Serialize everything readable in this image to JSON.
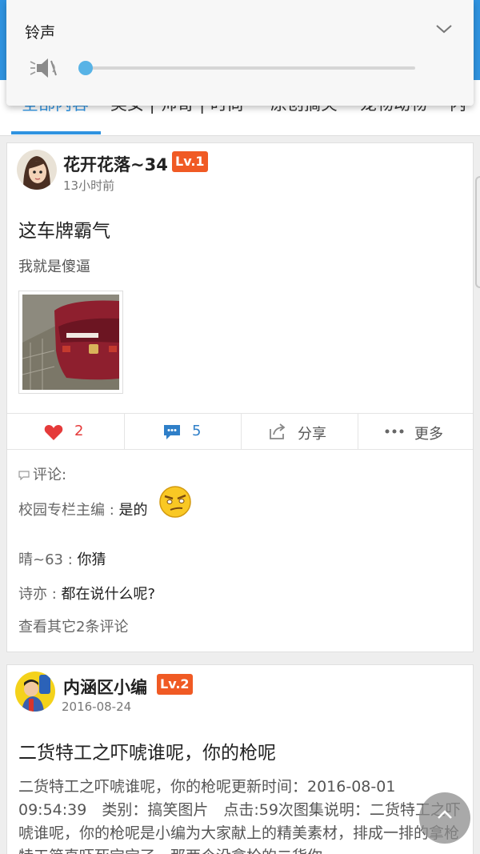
{
  "volume_panel": {
    "title": "铃声",
    "level_percent": 0,
    "icons": [
      "chevron-down-icon",
      "speaker-mute-icon"
    ],
    "accent_color": "#58b3e6"
  },
  "tabs": [
    {
      "label": "全部内容",
      "active": true
    },
    {
      "label": "美女 | 帅哥 | 时尚",
      "active": false
    },
    {
      "label": "原创搞笑",
      "active": false
    },
    {
      "label": "宠物动物",
      "active": false
    },
    {
      "label": "内",
      "active": false
    }
  ],
  "brand_color": "#2f93e0",
  "posts": [
    {
      "username": "花开花落~34",
      "level": "Lv.1",
      "time": "13小时前",
      "title": "这车牌霸气",
      "subtitle": "我就是傻逼",
      "actions": {
        "likes": "2",
        "comments": "5",
        "share": "分享",
        "more": "更多"
      },
      "comments_label": "评论:",
      "comments": [
        {
          "user": "校园专栏主编 : ",
          "text": "是的"
        },
        {
          "user": "晴~63 : ",
          "text": "你猜"
        },
        {
          "user": "诗亦 : ",
          "text": "都在说什么呢?"
        }
      ],
      "more_comments": "查看其它2条评论"
    },
    {
      "username": "内涵区小编",
      "level": "Lv.2",
      "time": "2016-08-24",
      "title": "二货特工之吓唬谁呢，你的枪呢",
      "body": "二货特工之吓唬谁呢，你的枪呢更新时间：2016-08-01 09:54:39　类别：搞笑图片　点击:59次图集说明：二货特工之吓唬谁呢，你的枪呢是小编为大家献上的精美素材，排成一排的拿枪特工简直吓死宝宝了，那两个没拿枪的二货你"
    }
  ]
}
